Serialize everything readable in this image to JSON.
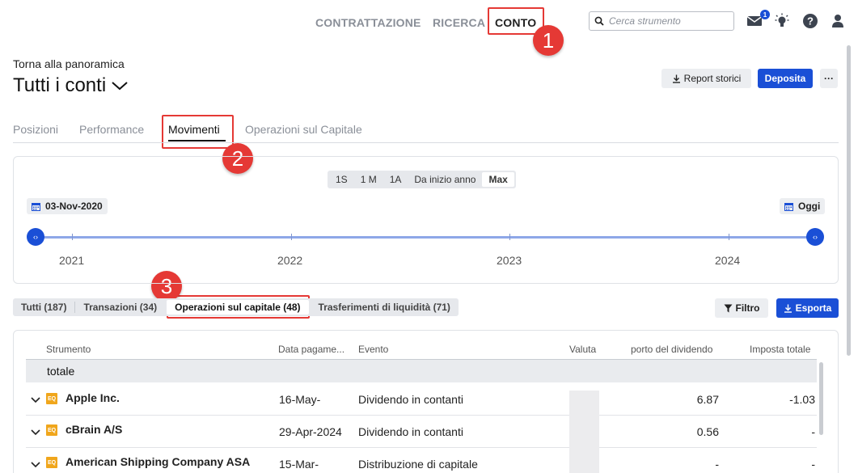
{
  "nav": {
    "items": [
      "CONTRATTAZIONE",
      "RICERCA",
      "CONTO"
    ],
    "search_placeholder": "Cerca strumento",
    "mail_count": "1"
  },
  "annotations": [
    "1",
    "2",
    "3"
  ],
  "header": {
    "back_link": "Torna alla panoramica",
    "title": "Tutti i conti",
    "report_button": "Report storici",
    "deposit_button": "Deposita",
    "more_button": "···"
  },
  "tabs": [
    "Posizioni",
    "Performance",
    "Movimenti",
    "Operazioni sul Capitale"
  ],
  "timeline": {
    "ranges": [
      "1S",
      "1 M",
      "1A",
      "Da inizio anno",
      "Max"
    ],
    "active_range": "Max",
    "start_date": "03-Nov-2020",
    "end_date": "Oggi",
    "years": [
      "2021",
      "2022",
      "2023",
      "2024"
    ]
  },
  "filters": {
    "pills": [
      "Tutti (187)",
      "Transazioni (34)",
      "Operazioni sul capitale (48)",
      "Trasferimenti di liquidità (71)"
    ],
    "active": "Operazioni sul capitale (48)",
    "filter_button": "Filtro",
    "export_button": "Esporta"
  },
  "table": {
    "headers": [
      "Strumento",
      "Data pagame...",
      "Evento",
      "Valuta",
      "porto del dividendo",
      "Imposta totale"
    ],
    "total_label": "totale",
    "rows": [
      {
        "badge": "EQ",
        "instrument": "Apple Inc.",
        "date": "16-May-",
        "event": "Dividendo in contanti",
        "amount": "6.87",
        "tax": "-1.03"
      },
      {
        "badge": "EQ",
        "instrument": "cBrain A/S",
        "date": "29-Apr-2024",
        "event": "Dividendo in contanti",
        "amount": "0.56",
        "tax": "-"
      },
      {
        "badge": "EQ",
        "instrument": "American Shipping Company ASA",
        "date": "15-Mar-",
        "event": "Distribuzione di capitale",
        "amount": "-",
        "tax": "-"
      }
    ]
  },
  "colors": {
    "accent": "#1a4fd6",
    "highlight": "#e53935",
    "equity_badge": "#f0a61c"
  }
}
